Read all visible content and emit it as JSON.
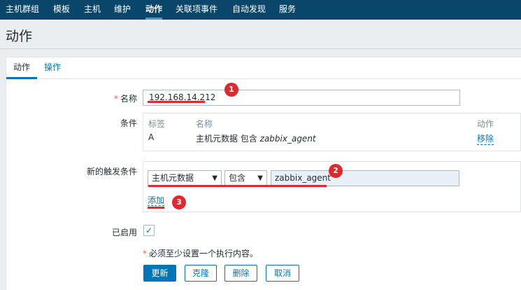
{
  "topnav": {
    "items": [
      {
        "label": "主机群组"
      },
      {
        "label": "模板"
      },
      {
        "label": "主机"
      },
      {
        "label": "维护"
      },
      {
        "label": "动作"
      },
      {
        "label": "关联项事件"
      },
      {
        "label": "自动发现"
      },
      {
        "label": "服务"
      }
    ]
  },
  "page": {
    "title": "动作"
  },
  "tabs": [
    {
      "label": "动作"
    },
    {
      "label": "操作"
    }
  ],
  "form": {
    "required_mark": "*",
    "name_label": "名称",
    "name_value": "192.168.14.212",
    "conditions_label": "条件",
    "conditions_table": {
      "headers": {
        "tag": "标签",
        "name": "名称",
        "action": "动作"
      },
      "rows": [
        {
          "tag": "A",
          "name_prefix": "主机元数据 包含 ",
          "name_value": "zabbix_agent",
          "action": "移除"
        }
      ]
    },
    "new_condition_label": "新的触发条件",
    "new_condition": {
      "type_select": "主机元数据",
      "operator_select": "包含",
      "value": "zabbix_agent",
      "add_link": "添加"
    },
    "enabled_label": "已启用",
    "enabled": true,
    "note": "必须至少设置一个执行内容。"
  },
  "buttons": {
    "update": "更新",
    "clone": "克隆",
    "delete": "删除",
    "cancel": "取消"
  },
  "annotations": {
    "badge1": "1",
    "badge2": "2",
    "badge3": "3"
  },
  "icons": {
    "dropdown": "triangle-down-icon",
    "check": "check-icon"
  },
  "colors": {
    "nav_bg": "#0a466a",
    "link": "#0275b8",
    "annotation": "#e0282e",
    "required": "#e45959"
  }
}
